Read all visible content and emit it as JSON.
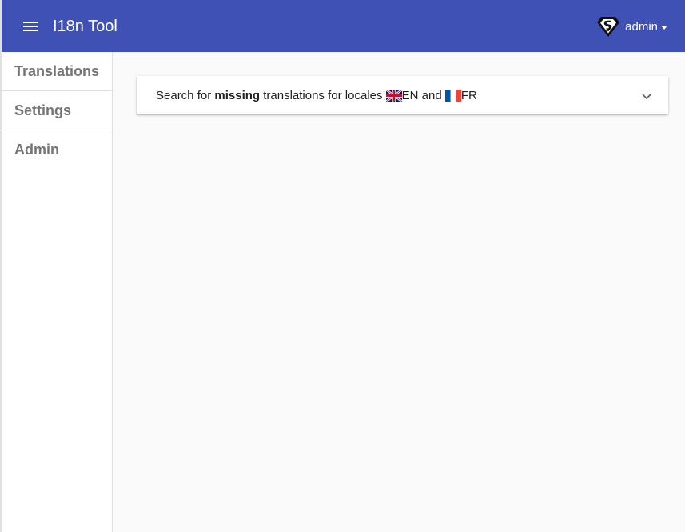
{
  "appbar": {
    "title": "I18n Tool",
    "user": "admin",
    "color": "#3f51b5"
  },
  "sidebar": {
    "items": [
      {
        "label": "Translations"
      },
      {
        "label": "Settings"
      },
      {
        "label": "Admin"
      }
    ]
  },
  "search_panel": {
    "prefix": "Search for ",
    "emphasis": "missing",
    "middle": " translations for locales ",
    "locale1": "EN",
    "connector": " and ",
    "locale2": "FR",
    "expand_icon": "chevron-down-icon"
  }
}
